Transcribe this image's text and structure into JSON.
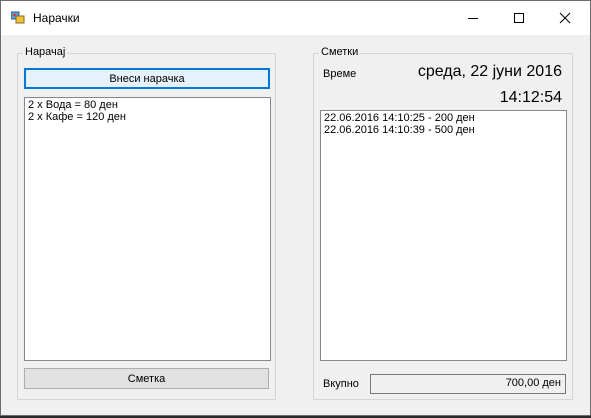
{
  "window": {
    "title": "Нарачки"
  },
  "orders": {
    "group_label": "Нарачај",
    "add_button": "Внеси нарачка",
    "items": [
      "2 x Вода = 80 ден",
      "2 x Кафе = 120 ден"
    ],
    "bill_button": "Сметка"
  },
  "bills": {
    "group_label": "Сметки",
    "time_label": "Време",
    "date": "среда, 22 јуни 2016",
    "time": "14:12:54",
    "items": [
      "22.06.2016 14:10:25 - 200 ден",
      "22.06.2016 14:10:39 - 500 ден"
    ],
    "total_label": "Вкупно",
    "total_value": "700,00 ден"
  },
  "icons": {
    "app": "form-app-icon",
    "minimize": "minimize-icon",
    "maximize": "maximize-icon",
    "close": "close-icon"
  }
}
